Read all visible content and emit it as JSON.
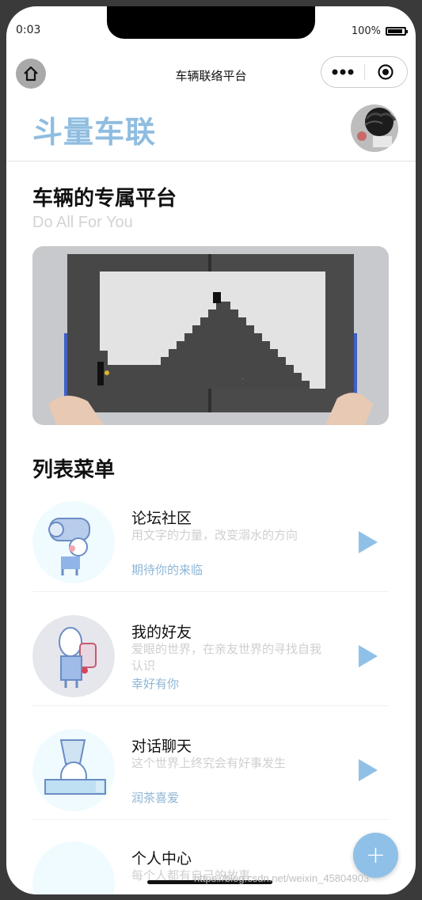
{
  "status_bar": {
    "time": "0:03",
    "battery": "100%"
  },
  "nav": {
    "title": "车辆联络平台"
  },
  "header": {
    "brand": "斗量车联"
  },
  "hero": {
    "title": "车辆的专属平台",
    "subtitle": "Do All For You"
  },
  "list": {
    "title": "列表菜单",
    "items": [
      {
        "title": "论坛社区",
        "desc": "用文字的力量，改变溺水的方向",
        "tag": "期待你的来临",
        "icon": "robot-scroll-icon"
      },
      {
        "title": "我的好友",
        "desc": "爱眼的世界，在亲友世界的寻找自我认识",
        "tag": "幸好有你",
        "icon": "drum-character-icon"
      },
      {
        "title": "对话聊天",
        "desc": "这个世界上终究会有好事发生",
        "tag": "润茶喜爱",
        "icon": "chat-character-icon"
      },
      {
        "title": "个人中心",
        "desc": "每个人都有自己的故事",
        "tag": "",
        "icon": "person-center-icon"
      }
    ]
  },
  "fab": {
    "label": "+"
  },
  "watermark": "https://blog.csdn.net/weixin_45804903",
  "colors": {
    "accent": "#8fbde0",
    "tag": "#8db6d6",
    "fab": "#8fc1e8"
  }
}
